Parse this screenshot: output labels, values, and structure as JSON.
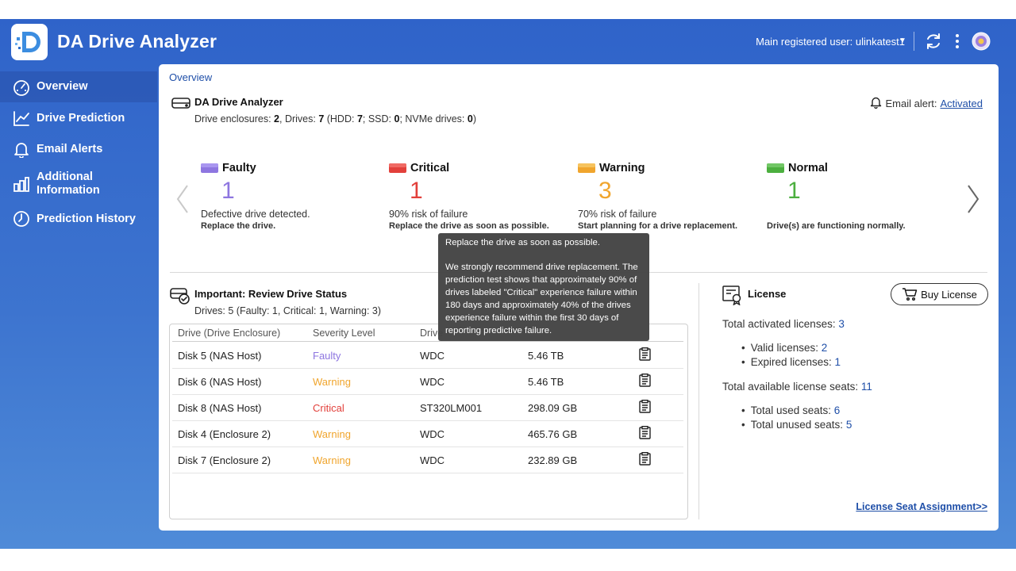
{
  "app": {
    "title": "DA Drive Analyzer"
  },
  "header": {
    "user_label": "Main registered user: ulinkatest1",
    "icons": [
      "chevron-down-icon",
      "refresh-icon",
      "more-vertical-icon",
      "profile-icon"
    ]
  },
  "sidebar": {
    "items": [
      {
        "label": "Overview",
        "icon": "gauge-icon",
        "active": true
      },
      {
        "label": "Drive Prediction",
        "icon": "line-chart-icon"
      },
      {
        "label": "Email Alerts",
        "icon": "bell-icon"
      },
      {
        "label": "Additional Information",
        "label_line1": "Additional",
        "label_line2": "Information",
        "icon": "bar-chart-icon"
      },
      {
        "label": "Prediction History",
        "icon": "clock-icon"
      }
    ]
  },
  "breadcrumb": "Overview",
  "summary": {
    "title": "DA Drive Analyzer",
    "enclosures_label": "Drive enclosures: ",
    "enclosures": "2",
    "drives_label": ", Drives: ",
    "drives": "7",
    "hdd_label": " (HDD: ",
    "hdd": "7",
    "ssd_label": "; SSD: ",
    "ssd": "0",
    "nvme_label": "; NVMe drives: ",
    "nvme": "0",
    "close_paren": ")"
  },
  "email_alert": {
    "label": "Email alert: ",
    "status": "Activated"
  },
  "severity_cards": {
    "faulty": {
      "label": "Faulty",
      "count": "1",
      "description": "Defective drive detected.",
      "action": "Replace the drive.",
      "color": "#8e76e0"
    },
    "critical": {
      "label": "Critical",
      "count": "1",
      "description": "90% risk of failure",
      "action": "Replace the drive as soon as possible.",
      "color": "#e2403b"
    },
    "warning": {
      "label": "Warning",
      "count": "3",
      "description": "70% risk of failure",
      "action": "Start planning for a drive replacement.",
      "color": "#f0a52d"
    },
    "normal": {
      "label": "Normal",
      "count": "1",
      "description": "",
      "action": "Drive(s) are functioning normally.",
      "color": "#4caf3f"
    }
  },
  "tooltip": {
    "line1": "Replace the drive as soon as possible.",
    "line2": "We strongly recommend drive replacement. The prediction test shows that approximately 90% of drives labeled \"Critical\" experience failure within 180 days and approximately 40% of the drives experience failure within the first 30 days of reporting predictive failure."
  },
  "review": {
    "title": "Important: Review Drive Status",
    "subtitle": "Drives: 5 (Faulty: 1, Critical: 1, Warning: 3)",
    "columns": [
      "Drive (Drive Enclosure)",
      "Severity Level",
      "Drive",
      "",
      ""
    ],
    "rows": [
      {
        "drive": "Disk 5 (NAS Host)",
        "severity": "Faulty",
        "model": "WDC",
        "capacity": "5.46 TB"
      },
      {
        "drive": "Disk 6 (NAS Host)",
        "severity": "Warning",
        "model": "WDC",
        "capacity": "5.46 TB"
      },
      {
        "drive": "Disk 8 (NAS Host)",
        "severity": "Critical",
        "model": "ST320LM001",
        "capacity": "298.09 GB"
      },
      {
        "drive": "Disk 4 (Enclosure 2)",
        "severity": "Warning",
        "model": "WDC",
        "capacity": "465.76 GB"
      },
      {
        "drive": "Disk 7 (Enclosure 2)",
        "severity": "Warning",
        "model": "WDC",
        "capacity": "232.89 GB"
      }
    ]
  },
  "license": {
    "title": "License",
    "buy_label": "Buy License",
    "total_activated_label": "Total activated licenses: ",
    "total_activated": "3",
    "valid_label": "Valid licenses: ",
    "valid": "2",
    "expired_label": "Expired licenses: ",
    "expired": "1",
    "seats_label": "Total available license seats: ",
    "seats": "11",
    "used_label": "Total used seats: ",
    "used": "6",
    "unused_label": "Total unused seats: ",
    "unused": "5",
    "seat_link": "License Seat Assignment>>"
  }
}
